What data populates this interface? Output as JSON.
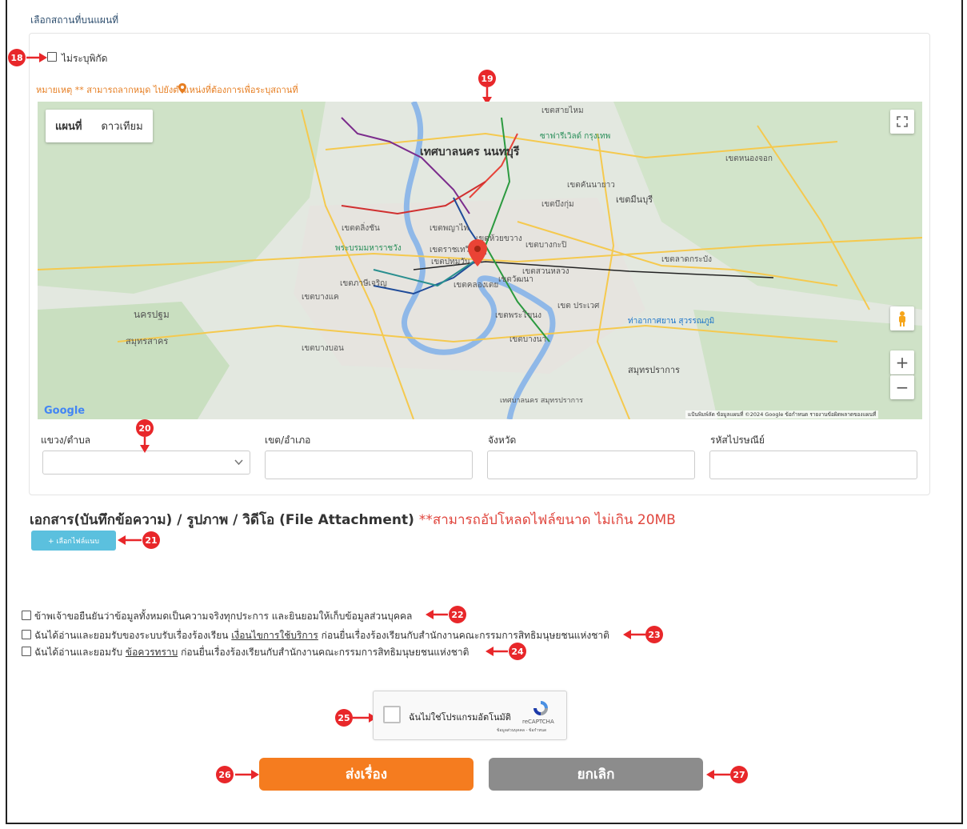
{
  "section_label": "เลือกสถานที่บนแผนที่",
  "no_coords_label": "ไม่ระบุพิกัด",
  "note_text": "หมายเหตุ ** สามารถลากหมุด  ไปยังตำแหน่งที่ต้องการเพื่อระบุสถานที่",
  "map": {
    "tab_map": "แผนที่",
    "tab_satellite": "ดาวเทียม",
    "logo": "Google",
    "attribution": "แป้นพิมพ์ลัด   ข้อมูลแผนที่ ©2024 Google   ข้อกำหนด   รายงานข้อผิดพลาดของแผนที่",
    "places": [
      "เทศบาลนคร นนทบุรี",
      "เขตสายไหม",
      "ซาฟารีเวิลด์ กรุงเทพ",
      "เขตหนองจอก",
      "เขตมีนบุรี",
      "เขตคันนายาว",
      "เขตบึงกุ่ม",
      "เขตตลิ่งชัน",
      "เขตพญาไท",
      "เขตห้วยขวาง",
      "เขตบางกะปิ",
      "พระบรมมหาราชวัง",
      "เขตราชเทวี",
      "เขตปทุมวัน",
      "เขตลาดกระบัง",
      "เขตภาษีเจริญ",
      "เขตวัฒนา",
      "เขตสวนหลวง",
      "เขตคลองเตย",
      "นครปฐม",
      "สมุทรสาคร",
      "เขตบางแค",
      "เขตพระโขนง",
      "เขต ประเวศ",
      "ท่าอากาศยาน สุวรรณภูมิ",
      "เขตบางบอน",
      "เขตบางนา",
      "สมุทรปราการ",
      "เทศบาลนคร สมุทรปราการ"
    ]
  },
  "fields": [
    {
      "label": "แขวง/ตำบล"
    },
    {
      "label": "เขต/อำเภอ"
    },
    {
      "label": "จังหวัด"
    },
    {
      "label": "รหัสไปรษณีย์"
    }
  ],
  "attachment": {
    "title": "เอกสาร(บันทึกข้อความ) / รูปภาพ / วิดีโอ (File Attachment)",
    "limit": "**สามารถอัปโหลดไฟล์ขนาด ไม่เกิน 20MB",
    "button": "+ เลือกไฟล์แนบ"
  },
  "agreements": {
    "a1": "ข้าพเจ้าขอยืนยันว่าข้อมูลทั้งหมดเป็นความจริงทุกประการ และยินยอมให้เก็บข้อมูลส่วนบุคคล",
    "a2_pre": "ฉันได้อ่านและยอมรับของระบบรับเรื่องร้องเรียน ",
    "a2_link": "เงื่อนไขการใช้บริการ",
    "a2_post": " ก่อนยื่นเรื่องร้องเรียนกับสำนักงานคณะกรรมการสิทธิมนุษยชนแห่งชาติ",
    "a3_pre": "ฉันได้อ่านและยอมรับ ",
    "a3_link": "ข้อควรทราบ",
    "a3_post": " ก่อนยื่นเรื่องร้องเรียนกับสำนักงานคณะกรรมการสิทธิมนุษยชนแห่งชาติ"
  },
  "captcha": {
    "label": "ฉันไม่ใช่โปรแกรมอัตโนมัติ",
    "brand": "reCAPTCHA",
    "links": "ข้อมูลส่วนบุคคล - ข้อกำหนด"
  },
  "buttons": {
    "submit": "ส่งเรื่อง",
    "cancel": "ยกเลิก"
  },
  "badges": [
    "18",
    "19",
    "20",
    "21",
    "22",
    "23",
    "24",
    "25",
    "26",
    "27"
  ],
  "colors": {
    "badge": "#e8272a",
    "submit": "#f57c1f",
    "cancel": "#8c8c8c",
    "attach": "#5bc0de",
    "note": "#e67e22"
  }
}
